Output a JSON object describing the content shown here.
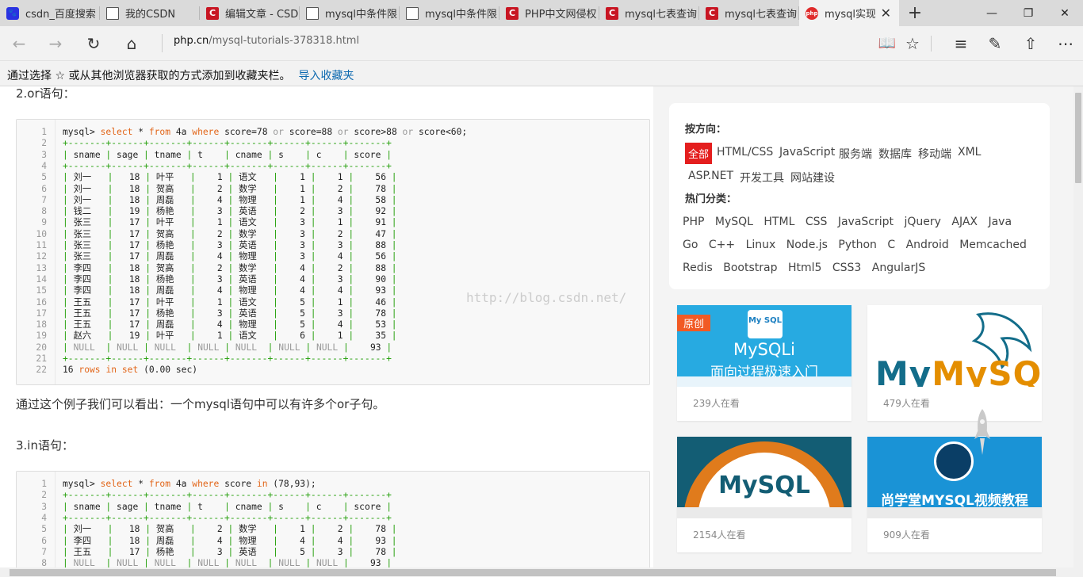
{
  "tabs": [
    {
      "icon": "baidu-paw-icon",
      "label": "csdn_百度搜索"
    },
    {
      "icon": "page-icon",
      "label": "我的CSDN"
    },
    {
      "icon": "csdn-icon",
      "label": "编辑文章 - CSD"
    },
    {
      "icon": "page-icon",
      "label": "mysql中条件限"
    },
    {
      "icon": "page-icon",
      "label": "mysql中条件限"
    },
    {
      "icon": "csdn-icon",
      "label": "PHP中文网侵权"
    },
    {
      "icon": "csdn-icon",
      "label": "mysql七表查询"
    },
    {
      "icon": "csdn-icon",
      "label": "mysql七表查询"
    },
    {
      "icon": "php-icon",
      "label": "mysql实现"
    }
  ],
  "address": {
    "domain": "php.cn",
    "path": "/mysql-tutorials-378318.html"
  },
  "favbar": {
    "text": "通过选择 ☆ 或从其他浏览器获取的方式添加到收藏夹栏。",
    "link": "导入收藏夹"
  },
  "article": {
    "heading_or": "2.or语句：",
    "note_or": "通过这个例子我们可以看出：一个mysql语句中可以有许多个or子句。",
    "heading_in": "3.in语句：",
    "watermark": "http://blog.csdn.net/"
  },
  "code1": {
    "lines": [
      "mysql> select * from 4a where score=78 or score=88 or score>88 or score<60;",
      "+-------+------+-------+------+-------+------+------+-------+",
      "| sname | sage | tname | t    | cname | s    | c    | score |",
      "+-------+------+-------+------+-------+------+------+-------+",
      "| 刘一   |   18 | 叶平   |    1 | 语文   |    1 |    1 |    56 |",
      "| 刘一   |   18 | 贺高   |    2 | 数学   |    1 |    2 |    78 |",
      "| 刘一   |   18 | 周磊   |    4 | 物理   |    1 |    4 |    58 |",
      "| 钱二   |   19 | 杨艳   |    3 | 英语   |    2 |    3 |    92 |",
      "| 张三   |   17 | 叶平   |    1 | 语文   |    3 |    1 |    91 |",
      "| 张三   |   17 | 贺高   |    2 | 数学   |    3 |    2 |    47 |",
      "| 张三   |   17 | 杨艳   |    3 | 英语   |    3 |    3 |    88 |",
      "| 张三   |   17 | 周磊   |    4 | 物理   |    3 |    4 |    56 |",
      "| 李四   |   18 | 贺高   |    2 | 数学   |    4 |    2 |    88 |",
      "| 李四   |   18 | 杨艳   |    3 | 英语   |    4 |    3 |    90 |",
      "| 李四   |   18 | 周磊   |    4 | 物理   |    4 |    4 |    93 |",
      "| 王五   |   17 | 叶平   |    1 | 语文   |    5 |    1 |    46 |",
      "| 王五   |   17 | 杨艳   |    3 | 英语   |    5 |    3 |    78 |",
      "| 王五   |   17 | 周磊   |    4 | 物理   |    5 |    4 |    53 |",
      "| 赵六   |   19 | 叶平   |    1 | 语文   |    6 |    1 |    35 |",
      "| NULL  | NULL | NULL  | NULL | NULL  | NULL | NULL |    93 |",
      "+-------+------+-------+------+-------+------+------+-------+",
      "16 rows in set (0.00 sec)"
    ]
  },
  "code2": {
    "lines": [
      "mysql> select * from 4a where score in (78,93);",
      "+-------+------+-------+------+-------+------+------+-------+",
      "| sname | sage | tname | t    | cname | s    | c    | score |",
      "+-------+------+-------+------+-------+------+------+-------+",
      "| 刘一   |   18 | 贺高   |    2 | 数学   |    1 |    2 |    78 |",
      "| 李四   |   18 | 周磊   |    4 | 物理   |    4 |    4 |    93 |",
      "| 王五   |   17 | 杨艳   |    3 | 英语   |    5 |    3 |    78 |",
      "| NULL  | NULL | NULL  | NULL | NULL  | NULL | NULL |    93 |"
    ]
  },
  "sidebar": {
    "direction_title": "按方向：",
    "directions": [
      "全部",
      "HTML/CSS",
      "JavaScript",
      "服务端",
      "数据库",
      "移动端",
      "XML",
      "ASP.NET",
      "开发工具",
      "网站建设"
    ],
    "hot_title": "热门分类：",
    "hot": [
      "PHP",
      "MySQL",
      "HTML",
      "CSS",
      "JavaScript",
      "jQuery",
      "AJAX",
      "Java",
      "Go",
      "C++",
      "Linux",
      "Node.js",
      "Python",
      "C",
      "Android",
      "Memcached",
      "Redis",
      "Bootstrap",
      "Html5",
      "CSS3",
      "AngularJS"
    ],
    "courses": [
      {
        "badge": "原创",
        "logo": "My SQL",
        "line1": "MySQLi",
        "line2": "面向过程极速入门",
        "views": "239人在看"
      },
      {
        "logo": "MySQL",
        "views": "479人在看"
      },
      {
        "logo": "MySQL",
        "views": "2154人在看"
      },
      {
        "title": "尚学堂MYSQL视频教程",
        "views": "909人在看"
      }
    ]
  },
  "colors": {
    "accent": "#e41e1e",
    "keyword": "#e2661a",
    "tableBorder": "#26a00d",
    "link": "#0e6ab0"
  }
}
